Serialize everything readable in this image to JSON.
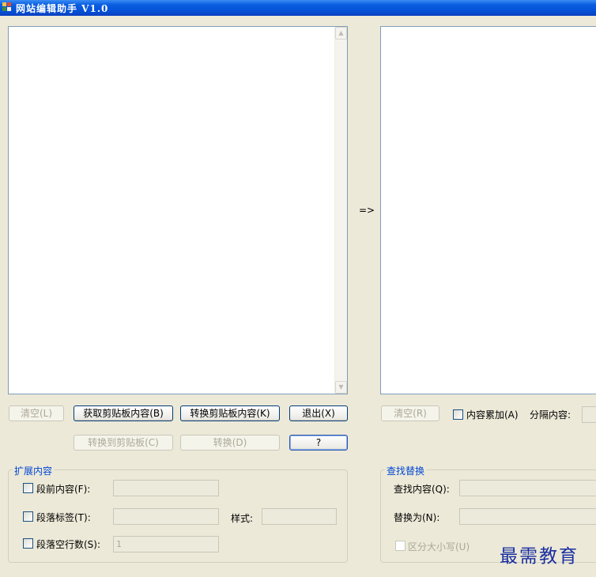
{
  "window": {
    "title": "网站编辑助手 V1.0",
    "icon": "app-icon"
  },
  "arrow": "=>",
  "left_panel": {
    "clear_label": "清空(L)",
    "get_clipboard_label": "获取剪贴板内容(B)",
    "convert_clipboard_label": "转换剪贴板内容(K)",
    "exit_label": "退出(X)",
    "convert_to_clipboard_label": "转换到剪贴板(C)",
    "convert_label": "转换(D)",
    "help_label": "?"
  },
  "right_panel": {
    "clear_label": "清空(R)",
    "accumulate_label": "内容累加(A)",
    "separator_label": "分隔内容:"
  },
  "extend_group": {
    "title": "扩展内容",
    "before_label": "段前内容(F):",
    "tag_label": "段落标签(T):",
    "style_label": "样式:",
    "blank_lines_label": "段落空行数(S):",
    "blank_lines_value": "1"
  },
  "find_group": {
    "title": "查找替换",
    "find_label": "查找内容(Q):",
    "replace_label": "替换为(N):",
    "case_label": "区分大小写(U)"
  },
  "watermark": "最需教育",
  "colors": {
    "titlebar": "#0a5ee0",
    "window_bg": "#ece9d8",
    "group_title": "#0046d5",
    "watermark": "#1a2ea0"
  }
}
